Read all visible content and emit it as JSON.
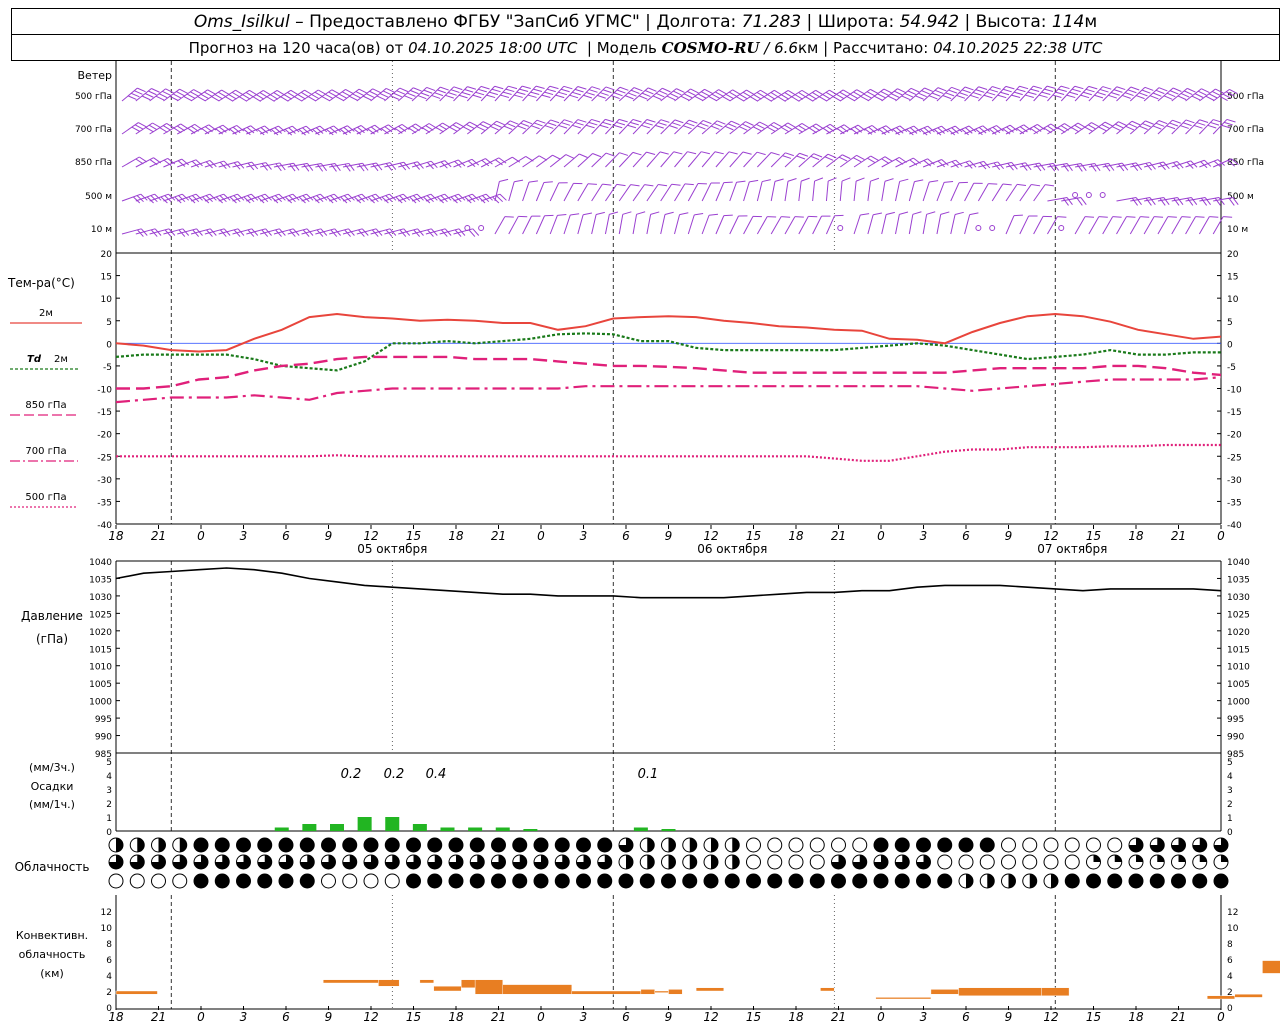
{
  "header": {
    "station": "Oms_Isilkul",
    "dash": " – ",
    "provider": "Предоставлено ФГБУ \"ЗапСиб УГМС\"",
    "sep": " | ",
    "lon_label": "Долгота:",
    "lon_value": "71.283",
    "lat_label": "Широта:",
    "lat_value": "54.942",
    "alt_label": "Высота:",
    "alt_value": "114",
    "alt_unit": "м"
  },
  "subheader": {
    "forecast_label": "Прогноз на 120 часа(ов) от",
    "forecast_from": "04.10.2025 18:00 UTC",
    "model_label": "| Модель",
    "model_name": "COSMO-RU",
    "model_res": "/ 6.6",
    "model_res_unit": "км",
    "calc_label": "| Рассчитано:",
    "calc_time": "04.10.2025 22:38 UTC"
  },
  "colors": {
    "wind": "#9a3fd0",
    "t2m": "#e8453c",
    "td2m": "#1a7a1a",
    "t850": "#e0207a",
    "t700": "#e0207a",
    "t500": "#e0207a",
    "pressure": "#000000",
    "precip": "#22b522",
    "convective": "#e87e22",
    "zero_line": "#4060ff"
  },
  "time_axis": {
    "hour_ticks": [
      "18",
      "21",
      "0",
      "3",
      "6",
      "9",
      "12",
      "15",
      "18",
      "21",
      "0",
      "3",
      "6",
      "9",
      "12",
      "15",
      "18",
      "21",
      "0",
      "3",
      "6",
      "9",
      "12",
      "15",
      "18",
      "21",
      "0"
    ],
    "day_labels": [
      "05 октября",
      "06 октября",
      "07 октября"
    ]
  },
  "chart_data": [
    {
      "type": "wind_barbs",
      "title": "Ветер",
      "levels": [
        "500 гПа",
        "700 гПа",
        "850 гПа",
        "500 м",
        "10 м"
      ],
      "note": "wind barbs at 3-hour steps for each level"
    },
    {
      "type": "line",
      "title": "Тем-ра(°C)",
      "ylim": [
        -40,
        20
      ],
      "yticks": [
        "20",
        "15",
        "10",
        "5",
        "0",
        "-5",
        "-10",
        "-15",
        "-20",
        "-25",
        "-30",
        "-35",
        "-40"
      ],
      "x_hours": [
        0,
        3,
        6,
        9,
        12,
        15,
        18,
        21,
        24,
        27,
        30,
        33,
        36,
        39,
        42,
        45,
        48,
        51,
        54,
        57,
        60,
        63,
        66,
        69,
        72,
        75,
        78,
        81,
        84,
        87,
        90,
        93,
        96,
        99,
        102,
        105,
        108,
        111,
        114,
        117,
        120
      ],
      "series": [
        {
          "name": "2м",
          "style": "solid",
          "values": [
            0,
            -0.5,
            -1.5,
            -1.8,
            -1.5,
            1,
            3,
            5.8,
            6.5,
            5.8,
            5.5,
            5,
            5.2,
            5,
            4.5,
            4.5,
            3,
            3.8,
            5.5,
            5.8,
            6,
            5.8,
            5,
            4.5,
            3.8,
            3.5,
            3,
            2.8,
            1,
            0.8,
            0,
            2.5,
            4.5,
            6,
            6.5,
            6,
            4.8,
            3,
            2,
            1,
            1.5
          ]
        },
        {
          "name": "Td 2м",
          "style": "dotted",
          "values": [
            -3,
            -2.5,
            -2.5,
            -2.5,
            -2.5,
            -3.5,
            -5,
            -5.5,
            -6,
            -4,
            0,
            0,
            0.5,
            0,
            0.5,
            1,
            2,
            2.2,
            2,
            0.5,
            0.5,
            -1,
            -1.5,
            -1.5,
            -1.5,
            -1.5,
            -1.5,
            -1,
            -0.5,
            0,
            -0.5,
            -1.5,
            -2.5,
            -3.5,
            -3,
            -2.5,
            -1.5,
            -2.5,
            -2.5,
            -2,
            -2
          ]
        },
        {
          "name": "850 гПа",
          "style": "dashed",
          "values": [
            -10,
            -10,
            -9.5,
            -8,
            -7.5,
            -6,
            -5,
            -4.5,
            -3.5,
            -3,
            -3,
            -3,
            -3,
            -3.5,
            -3.5,
            -3.5,
            -4,
            -4.5,
            -5,
            -5,
            -5.2,
            -5.5,
            -6,
            -6.5,
            -6.5,
            -6.5,
            -6.5,
            -6.5,
            -6.5,
            -6.5,
            -6.5,
            -6,
            -5.5,
            -5.5,
            -5.5,
            -5.5,
            -5,
            -5,
            -5.5,
            -6.5,
            -7
          ]
        },
        {
          "name": "700 гПа",
          "style": "dashdot",
          "values": [
            -13,
            -12.5,
            -12,
            -12,
            -12,
            -11.5,
            -12,
            -12.5,
            -11,
            -10.5,
            -10,
            -10,
            -10,
            -10,
            -10,
            -10,
            -10,
            -9.5,
            -9.5,
            -9.5,
            -9.5,
            -9.5,
            -9.5,
            -9.5,
            -9.5,
            -9.5,
            -9.5,
            -9.5,
            -9.5,
            -9.5,
            -10,
            -10.5,
            -10,
            -9.5,
            -9,
            -8.5,
            -8,
            -8,
            -8,
            -8,
            -7.5
          ]
        },
        {
          "name": "500 гПа",
          "style": "dotted",
          "values": [
            -25,
            -25,
            -25,
            -25,
            -25,
            -25,
            -25,
            -25,
            -24.8,
            -25,
            -25,
            -25,
            -25,
            -25,
            -25,
            -25,
            -25,
            -25,
            -25,
            -25,
            -25,
            -25,
            -25,
            -25,
            -25,
            -25,
            -25.5,
            -26,
            -26,
            -25,
            -24,
            -23.5,
            -23.5,
            -23,
            -23,
            -23,
            -22.8,
            -22.8,
            -22.5,
            -22.5,
            -22.5
          ]
        }
      ]
    },
    {
      "type": "line",
      "title": "Давление",
      "ylabel": "(гПа)",
      "ylim": [
        985,
        1040
      ],
      "yticks": [
        "1040",
        "1035",
        "1030",
        "1025",
        "1020",
        "1015",
        "1010",
        "1005",
        "1000",
        "995",
        "990",
        "985"
      ],
      "x_hours": [
        0,
        3,
        6,
        9,
        12,
        15,
        18,
        21,
        24,
        27,
        30,
        33,
        36,
        39,
        42,
        45,
        48,
        51,
        54,
        57,
        60,
        63,
        66,
        69,
        72,
        75,
        78,
        81,
        84,
        87,
        90,
        93,
        96,
        99,
        102,
        105,
        108,
        111,
        114,
        117,
        120
      ],
      "series": [
        {
          "name": "Давление",
          "values": [
            1035,
            1036.5,
            1037,
            1037.5,
            1038,
            1037.5,
            1036.5,
            1035,
            1034,
            1033,
            1032.5,
            1032,
            1031.5,
            1031,
            1030.5,
            1030.5,
            1030,
            1030,
            1030,
            1029.5,
            1029.5,
            1029.5,
            1029.5,
            1030,
            1030.5,
            1031,
            1031,
            1031.5,
            1031.5,
            1032.5,
            1033,
            1033,
            1033,
            1032.5,
            1032,
            1031.5,
            1032,
            1032,
            1032,
            1032,
            1031.5
          ]
        }
      ]
    },
    {
      "type": "bar",
      "title": "Осадки",
      "ylabel": "(мм/3ч.)",
      "ylabel2": "(мм/1ч.)",
      "ylim": [
        0,
        5
      ],
      "yticks": [
        "5",
        "4",
        "3",
        "2",
        "1",
        "0"
      ],
      "x_hours": [
        18,
        21,
        24,
        27,
        30,
        33,
        36,
        39,
        42,
        45,
        48,
        51,
        54,
        57,
        60
      ],
      "values": [
        0.1,
        0.2,
        0.2,
        0.4,
        0.4,
        0.2,
        0.1,
        0.1,
        0.1,
        0.05,
        0,
        0,
        0,
        0.1,
        0.05
      ],
      "totals": [
        "0.2",
        "0.2",
        "0.4",
        "0.1"
      ]
    },
    {
      "type": "table",
      "title": "Облачность",
      "rows": 3,
      "note": "cloud cover circles per hour for high / middle / low layers"
    },
    {
      "type": "bar",
      "title": "Конвективн. облачность",
      "ylabel": "(км)",
      "ylim": [
        0,
        14
      ],
      "yticks": [
        "12",
        "10",
        "8",
        "6",
        "4",
        "2",
        "0"
      ]
    }
  ],
  "labels": {
    "wind": "Ветер",
    "temp": "Тем-ра(°C)",
    "t2m": "2м",
    "td2m_a": "Td",
    "td2m_b": "2м",
    "t850": "850 гПа",
    "t700": "700 гПа",
    "t500": "500 гПа",
    "pressure": "Давление",
    "pressure_unit": "(гПа)",
    "precip_u3": "(мм/3ч.)",
    "precip": "Осадки",
    "precip_u1": "(мм/1ч.)",
    "clouds": "Облачность",
    "conv1": "Конвективн.",
    "conv2": "облачность",
    "conv3": "(км)"
  }
}
